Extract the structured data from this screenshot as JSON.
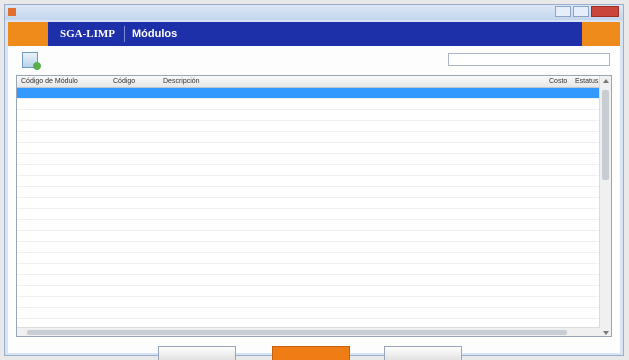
{
  "window": {
    "title": ""
  },
  "brand": {
    "name": "SGA-LIMP",
    "module": "Módulos"
  },
  "toolbar": {
    "new_label": "",
    "search_label": ""
  },
  "grid": {
    "columns": [
      "Código de Módulo",
      "Código",
      "Descripción",
      "Costo",
      "Estatus"
    ],
    "selected_index": 0,
    "rows_count": 22
  },
  "footer": {
    "buttons": [
      "",
      "",
      ""
    ]
  },
  "colors": {
    "brand_bar": "#1d2fa9",
    "accent": "#ee8b1b",
    "selection": "#3399ff"
  }
}
